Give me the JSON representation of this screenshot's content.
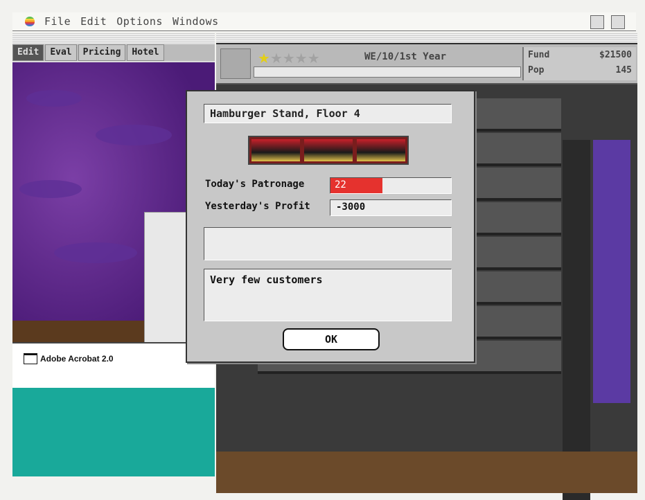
{
  "menubar": {
    "items": [
      "File",
      "Edit",
      "Options",
      "Windows"
    ]
  },
  "left_window": {
    "tabs": [
      "Edit",
      "Eval",
      "Pricing",
      "Hotel"
    ],
    "folder_label": "Adobe Acrobat 2.0"
  },
  "info_bar": {
    "date": "WE/10/1st Year",
    "fund_label": "Fund",
    "fund_value": "$21500",
    "pop_label": "Pop",
    "pop_value": "145",
    "stars_earned": 1,
    "stars_total": 5
  },
  "dialog": {
    "title": "Hamburger Stand, Floor 4",
    "patronage_label": "Today's Patronage",
    "patronage_value": "22",
    "patronage_fraction": 0.43,
    "profit_label": "Yesterday's Profit",
    "profit_value": "-3000",
    "message": "Very few customers",
    "ok_label": "OK"
  },
  "colors": {
    "patronage_fill": "#e5322e",
    "sky": "#4b1b77",
    "teal": "#19a99a"
  }
}
